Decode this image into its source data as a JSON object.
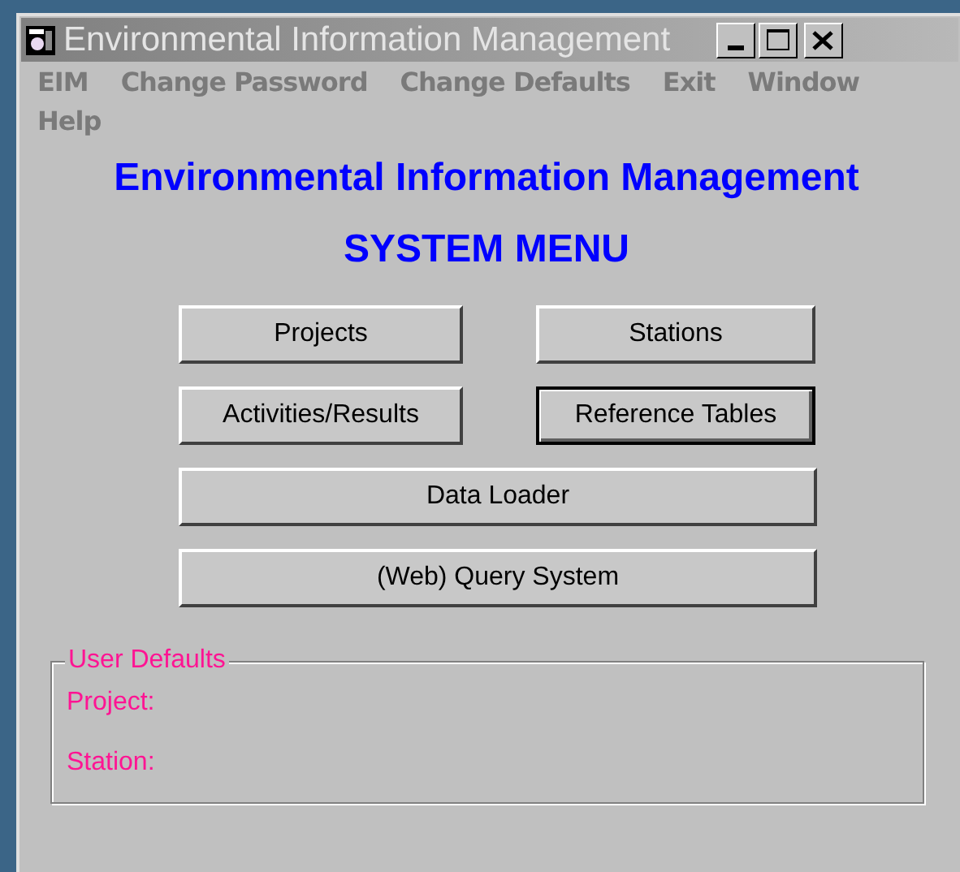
{
  "window": {
    "title": "Environmental Information Management",
    "active": false
  },
  "menu": [
    {
      "label": "EIM"
    },
    {
      "label": "Change Password"
    },
    {
      "label": "Change Defaults"
    },
    {
      "label": "Exit"
    },
    {
      "label": "Window"
    },
    {
      "label": "Help"
    }
  ],
  "heading": "Environmental Information Management",
  "subheading": "SYSTEM MENU",
  "buttons": [
    {
      "label": "Projects",
      "focused": false,
      "kind": "half"
    },
    {
      "label": "Stations",
      "focused": false,
      "kind": "half"
    },
    {
      "label": "Activities/Results",
      "focused": false,
      "kind": "half"
    },
    {
      "label": "Reference Tables",
      "focused": true,
      "kind": "half"
    },
    {
      "label": "Data Loader",
      "focused": false,
      "kind": "wide"
    },
    {
      "label": "(Web) Query System",
      "focused": false,
      "kind": "wide"
    }
  ],
  "user_defaults": {
    "title": "User Defaults",
    "fields": [
      {
        "label": "Project:"
      },
      {
        "label": "Station:"
      }
    ]
  }
}
